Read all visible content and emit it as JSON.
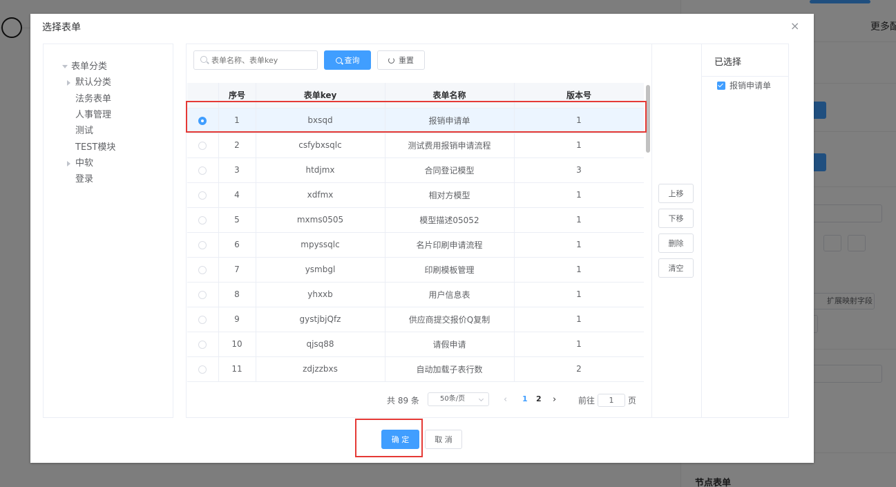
{
  "background": {
    "tab_more": "更多配",
    "extend_field_label": "扩展映射字段",
    "node_form_title": "节点表单"
  },
  "dialog": {
    "title": "选择表单",
    "close_glyph": "×"
  },
  "tree": {
    "root": "表单分类",
    "children": [
      "默认分类",
      "法务表单",
      "人事管理",
      "测试",
      "TEST模块",
      "中软",
      "登录"
    ]
  },
  "search": {
    "placeholder": "表单名称、表单key",
    "query_label": "查询",
    "reset_label": "重置"
  },
  "table": {
    "columns": [
      "",
      "序号",
      "表单key",
      "表单名称",
      "版本号"
    ],
    "rows": [
      {
        "index": "1",
        "key": "bxsqd",
        "name": "报销申请单",
        "version": "1",
        "selected": true
      },
      {
        "index": "2",
        "key": "csfybxsqlc",
        "name": "测试费用报销申请流程",
        "version": "1",
        "selected": false
      },
      {
        "index": "3",
        "key": "htdjmx",
        "name": "合同登记模型",
        "version": "3",
        "selected": false
      },
      {
        "index": "4",
        "key": "xdfmx",
        "name": "相对方模型",
        "version": "1",
        "selected": false
      },
      {
        "index": "5",
        "key": "mxms0505",
        "name": "模型描述05052",
        "version": "1",
        "selected": false
      },
      {
        "index": "6",
        "key": "mpyssqlc",
        "name": "名片印刷申请流程",
        "version": "1",
        "selected": false
      },
      {
        "index": "7",
        "key": "ysmbgl",
        "name": "印刷模板管理",
        "version": "1",
        "selected": false
      },
      {
        "index": "8",
        "key": "yhxxb",
        "name": "用户信息表",
        "version": "1",
        "selected": false
      },
      {
        "index": "9",
        "key": "gystjbjQfz",
        "name": "供应商提交报价Q复制",
        "version": "1",
        "selected": false
      },
      {
        "index": "10",
        "key": "qjsq88",
        "name": "请假申请",
        "version": "1",
        "selected": false
      },
      {
        "index": "11",
        "key": "zdjzzbxs",
        "name": "自动加载子表行数",
        "version": "2",
        "selected": false
      }
    ]
  },
  "pagination": {
    "total": "共 89 条",
    "page_size": "50条/页",
    "prev": "‹",
    "pages": [
      "1",
      "2"
    ],
    "next": "›",
    "goto_label": "前往",
    "goto_value": "1",
    "goto_unit": "页"
  },
  "move_buttons": {
    "up": "上移",
    "down": "下移",
    "delete": "删除",
    "clear": "清空"
  },
  "selected_panel": {
    "title": "已选择",
    "items": [
      "报销申请单"
    ]
  },
  "footer": {
    "ok": "确 定",
    "cancel": "取 消"
  },
  "colors": {
    "primary": "#409eff",
    "annotation_red": "#e53935",
    "selected_row_bg": "#ecf5ff"
  }
}
